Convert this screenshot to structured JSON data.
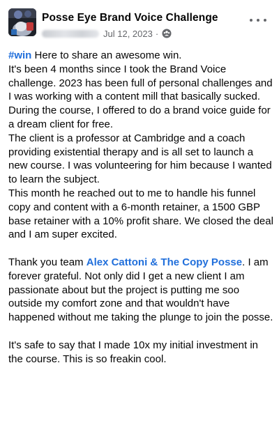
{
  "header": {
    "group_name": "Posse Eye Brand Voice Challenge",
    "date": "Jul 12, 2023",
    "separator": "·",
    "privacy_icon": "group-members-icon",
    "more_icon": "more-options-icon"
  },
  "post": {
    "hashtag": "#win",
    "line1_rest": " Here to share an awesome win.",
    "para1": "It's been 4 months since I took the Brand Voice challenge. 2023 has been full of personal challenges and I was working with a content mill that basically sucked. During the course, I offered to do a brand voice guide for a dream client for free.",
    "para2": "The client is a professor at Cambridge and a coach providing existential therapy and is all set to launch a new course. I was volunteering for him because I wanted to learn the subject.",
    "para3": "This month he reached out to me to handle his funnel copy and content with a 6-month retainer, a 1500 GBP base retainer with a 10% profit share. We closed the deal and I am super excited.",
    "thanks_before": "Thank you team ",
    "mention": "Alex Cattoni & The Copy Posse",
    "thanks_after": ". I am forever grateful. Not only did I get a new client I am passionate about but the project is putting me soo outside my comfort zone and that wouldn't have happened without me taking the plunge to join the posse.",
    "para5": "It's safe to say that I made 10x my initial investment in the course. This is so freakin cool."
  },
  "colors": {
    "link": "#216fdb",
    "meta": "#65676b",
    "text": "#050505"
  }
}
